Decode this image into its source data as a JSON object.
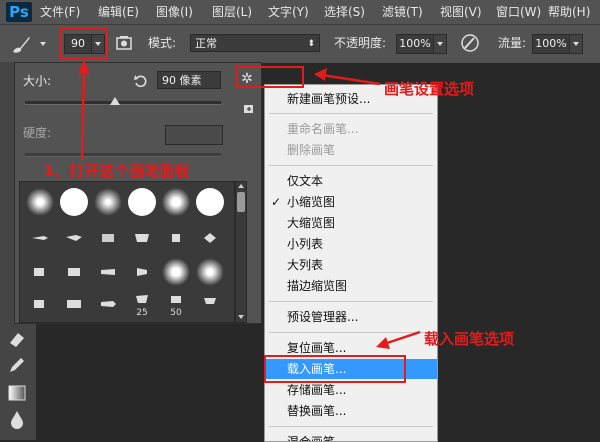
{
  "menubar": {
    "logo": "Ps",
    "items": [
      "文件(F)",
      "编辑(E)",
      "图像(I)",
      "图层(L)",
      "文字(Y)",
      "选择(S)",
      "滤镜(T)",
      "视图(V)",
      "窗口(W)",
      "帮助(H)"
    ]
  },
  "options": {
    "size_value": "90",
    "mode_label": "模式:",
    "mode_value": "正常",
    "opacity_label": "不透明度:",
    "opacity_value": "100%",
    "flow_label": "流量:",
    "flow_value": "100%"
  },
  "panel": {
    "size_label": "大小:",
    "size_value": "90 像素",
    "hardness_label": "硬度:",
    "size_slider_fraction": 0.46,
    "brush_numbers": [
      "25",
      "50"
    ]
  },
  "menu": {
    "items": [
      {
        "label": "新建画笔预设...",
        "disabled": false
      },
      {
        "label": "重命名画笔...",
        "disabled": true
      },
      {
        "label": "删除画笔",
        "disabled": true
      },
      {
        "label": "仅文本",
        "disabled": false
      },
      {
        "label": "小缩览图",
        "disabled": false,
        "checked": true
      },
      {
        "label": "大缩览图",
        "disabled": false
      },
      {
        "label": "小列表",
        "disabled": false
      },
      {
        "label": "大列表",
        "disabled": false
      },
      {
        "label": "描边缩览图",
        "disabled": false
      },
      {
        "label": "预设管理器...",
        "disabled": false
      },
      {
        "label": "复位画笔...",
        "disabled": false
      },
      {
        "label": "载入画笔...",
        "disabled": false,
        "selected": true
      },
      {
        "label": "存储画笔...",
        "disabled": false
      },
      {
        "label": "替换画笔...",
        "disabled": false
      },
      {
        "label": "混合画笔",
        "disabled": false
      }
    ],
    "check_mark": "✓"
  },
  "annotations": {
    "settings_option": "画笔设置选项",
    "open_panel": "1、打开这个画笔面板",
    "load_option": "载入画笔选项"
  },
  "colors": {
    "accent": "#e31b1b",
    "selection": "#3399ff"
  }
}
